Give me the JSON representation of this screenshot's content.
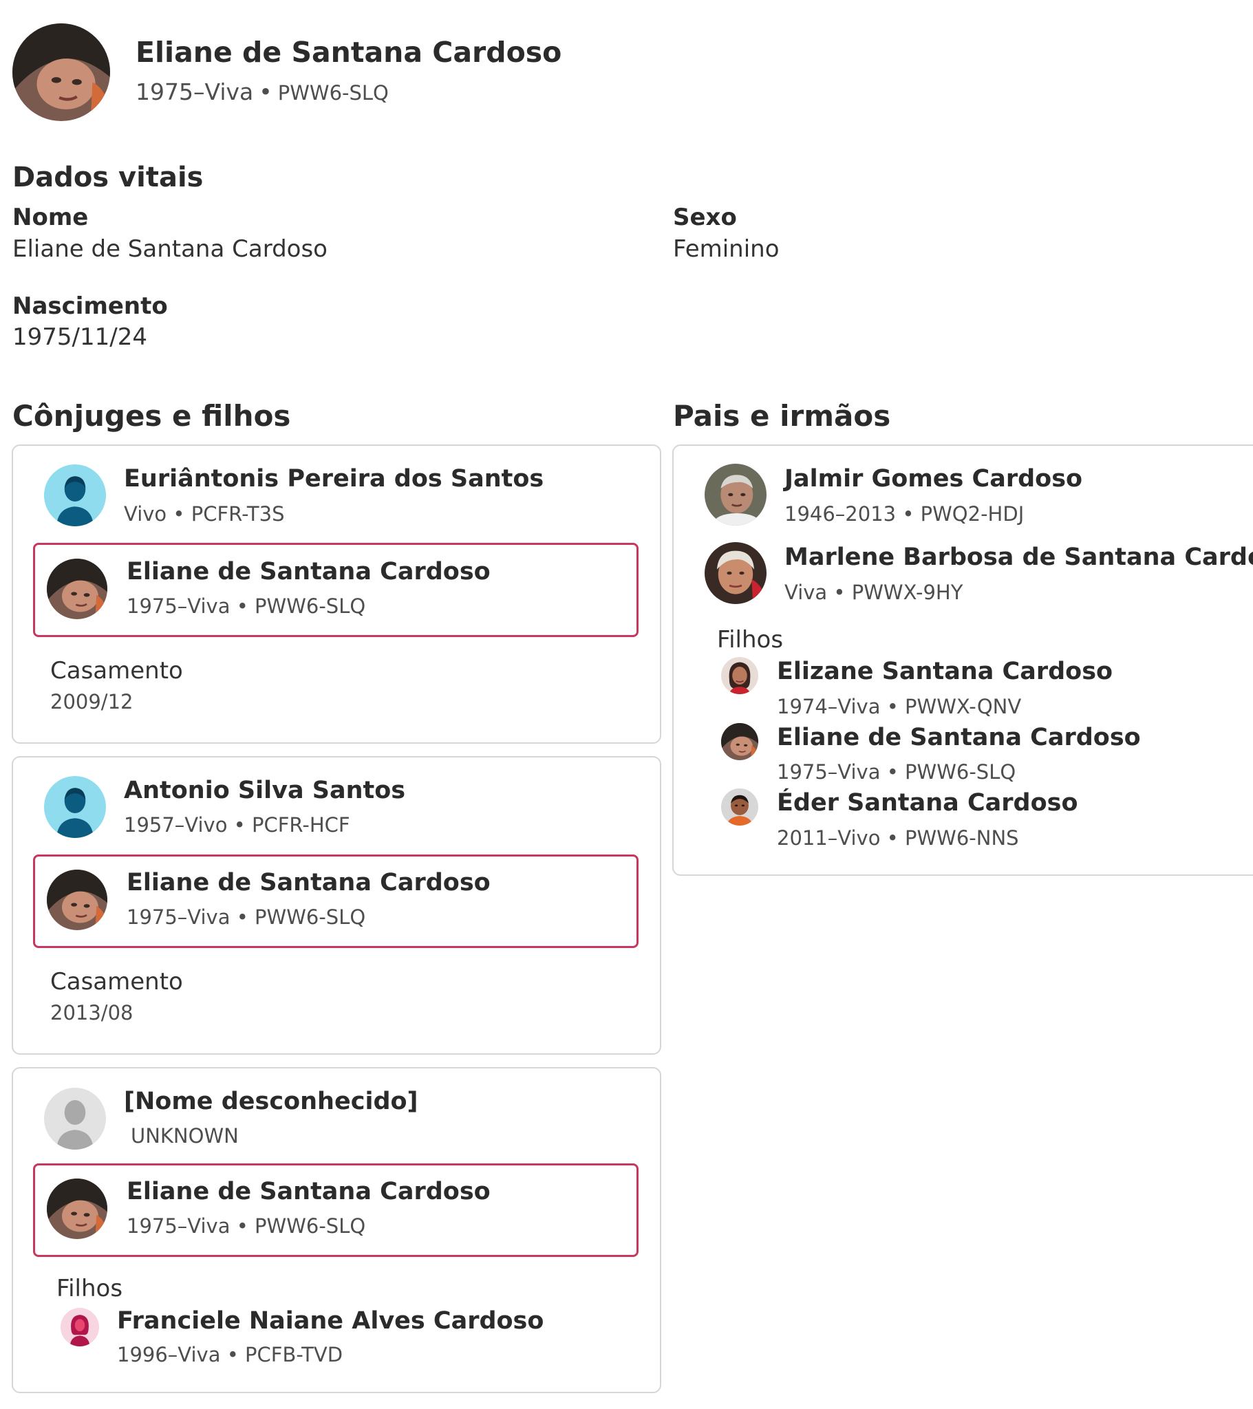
{
  "header": {
    "name": "Eliane de Santana Cardoso",
    "lifespan": "1975–Viva",
    "id": "PWW6-SLQ"
  },
  "vitals": {
    "title": "Dados vitais",
    "name_label": "Nome",
    "name_value": "Eliane de Santana Cardoso",
    "sex_label": "Sexo",
    "sex_value": "Feminino",
    "birth_label": "Nascimento",
    "birth_value": "1975/11/24"
  },
  "spouses_section": {
    "title": "Cônjuges e filhos",
    "families": [
      {
        "spouse_name": "Euriântonis Pereira dos Santos",
        "spouse_meta": "Vivo • PCFR-T3S",
        "self_name": "Eliane de Santana Cardoso",
        "self_meta": "1975–Viva • PWW6-SLQ",
        "event_label": "Casamento",
        "event_date": "2009/12"
      },
      {
        "spouse_name": "Antonio Silva Santos",
        "spouse_meta": "1957–Vivo • PCFR-HCF",
        "self_name": "Eliane de Santana Cardoso",
        "self_meta": "1975–Viva • PWW6-SLQ",
        "event_label": "Casamento",
        "event_date": "2013/08"
      },
      {
        "spouse_name": "[Nome desconhecido]",
        "spouse_meta": "UNKNOWN",
        "self_name": "Eliane de Santana Cardoso",
        "self_meta": "1975–Viva • PWW6-SLQ",
        "children_label": "Filhos",
        "children": [
          {
            "name": "Franciele Naiane Alves Cardoso",
            "meta": "1996–Viva • PCFB-TVD"
          }
        ]
      }
    ]
  },
  "parents_section": {
    "title": "Pais e irmãos",
    "father": {
      "name": "Jalmir Gomes Cardoso",
      "meta": "1946–2013 • PWQ2-HDJ"
    },
    "mother": {
      "name": "Marlene Barbosa de Santana Cardoso",
      "meta": "Viva • PWWX-9HY"
    },
    "children_label": "Filhos",
    "children": [
      {
        "name": "Elizane Santana Cardoso",
        "meta": "1974–Viva • PWWX-QNV"
      },
      {
        "name": "Eliane de Santana Cardoso",
        "meta": "1975–Viva • PWW6-SLQ"
      },
      {
        "name": "Éder Santana Cardoso",
        "meta": "2011–Vivo • PWW6-NNS"
      }
    ]
  },
  "colors": {
    "self_highlight": "#c8385e",
    "male_avatar_bg": "#8fdcef",
    "male_avatar_fg": "#0c5c82",
    "unknown_avatar_bg": "#e2e2e2",
    "female_avatar_bg": "#f7d6e2",
    "female_avatar_fg": "#b0164a"
  }
}
